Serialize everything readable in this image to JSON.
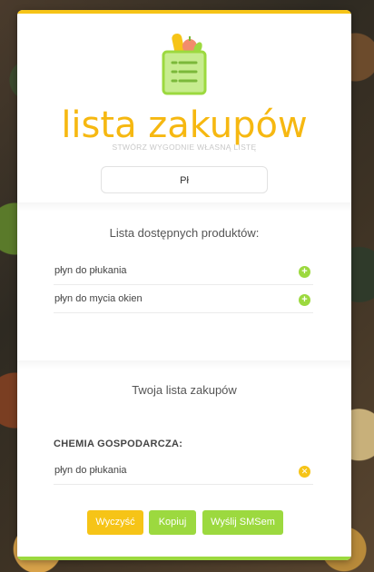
{
  "header": {
    "title": "lista zakupów",
    "subtitle": "STWÓRZ WYGODNIE WŁASNĄ LISTĘ",
    "input_value": "Pł"
  },
  "available": {
    "title": "Lista dostępnych produktów:",
    "items": [
      {
        "label": "płyn do płukania",
        "icon": "plus-circle-icon"
      },
      {
        "label": "płyn do mycia okien",
        "icon": "plus-circle-icon"
      }
    ]
  },
  "shopping": {
    "title": "Twoja lista zakupów",
    "category": "CHEMIA GOSPODARCZA:",
    "items": [
      {
        "label": "płyn do płukania",
        "icon": "remove-circle-icon"
      }
    ]
  },
  "buttons": {
    "clear": "Wyczyść",
    "copy": "Kopiuj",
    "sms": "Wyślij SMSem"
  },
  "colors": {
    "accent_yellow": "#f6c417",
    "accent_green": "#9cd93f",
    "title_color": "#f6b811"
  }
}
